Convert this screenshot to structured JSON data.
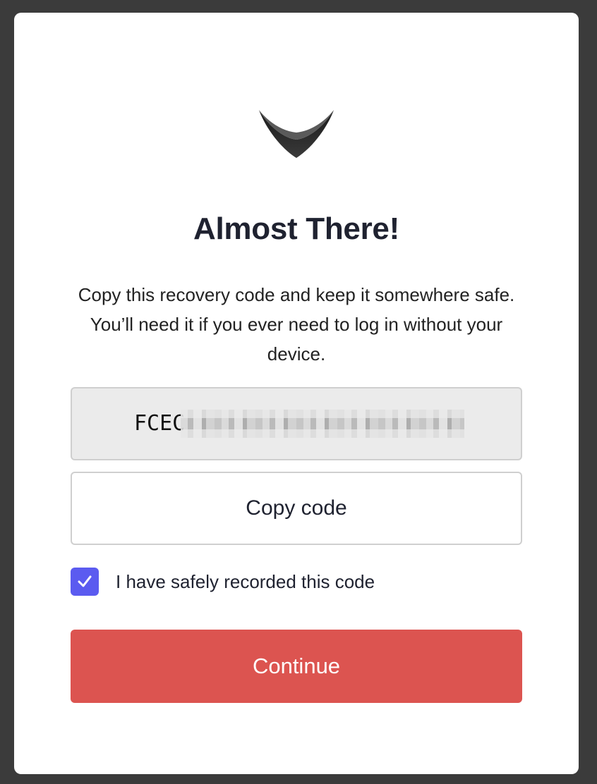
{
  "dialog": {
    "title": "Almost There!",
    "description": "Copy this recovery code and keep it somewhere safe. You’ll need it if you ever need to log in without your device.",
    "recovery_code_visible": "FCEC",
    "copy_button_label": "Copy code",
    "checkbox_label": "I have safely recorded this code",
    "checkbox_checked": true,
    "continue_button_label": "Continue"
  },
  "icons": {
    "logo": "chevron-v-logo",
    "checkbox": "checkmark-icon"
  },
  "colors": {
    "backdrop": "#3b3b3b",
    "card": "#ffffff",
    "accent_checkbox": "#5b5bf0",
    "primary_button": "#dc5450",
    "code_box": "#ebebeb"
  }
}
